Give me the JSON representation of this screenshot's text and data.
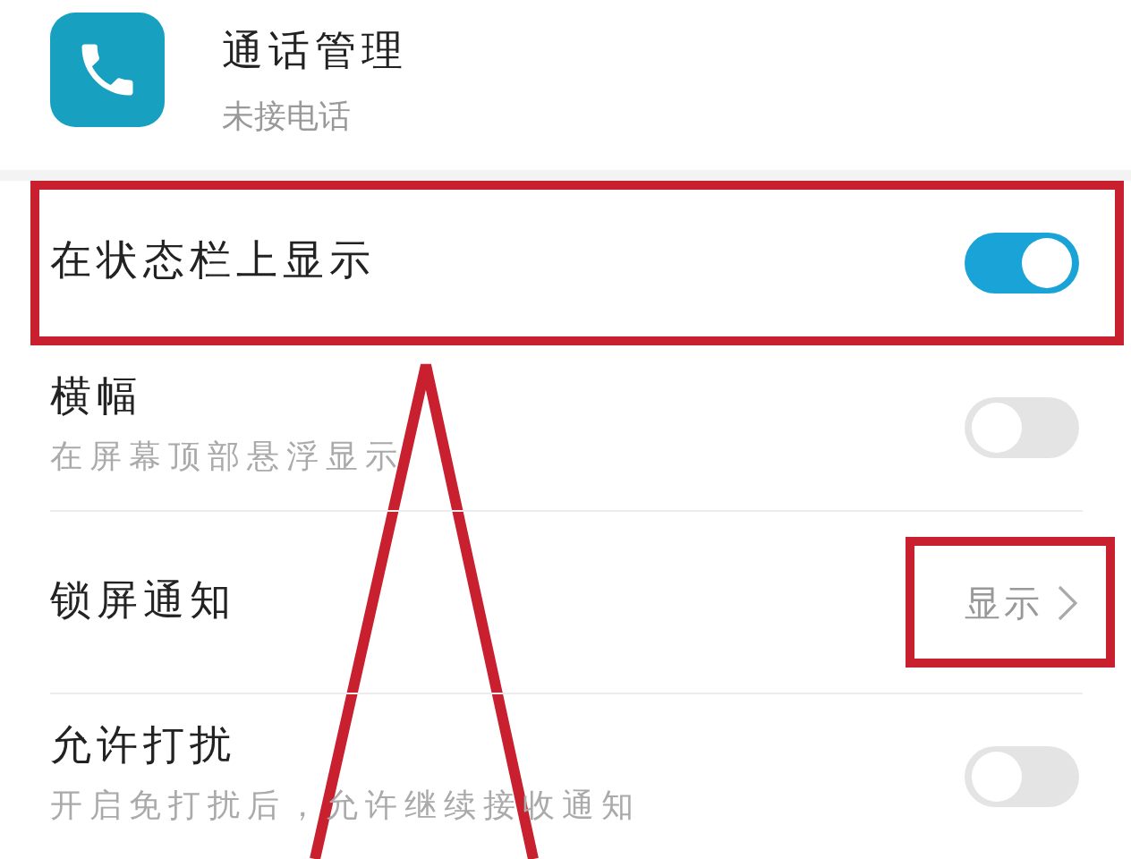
{
  "app": {
    "name": "通话管理",
    "subtitle": "未接电话"
  },
  "settings": [
    {
      "kind": "toggle",
      "label": "在状态栏上显示",
      "on": true,
      "highlighted": true
    },
    {
      "kind": "toggle",
      "label": "横幅",
      "description": "在屏幕顶部悬浮显示",
      "on": false,
      "highlighted": false
    },
    {
      "kind": "link",
      "label": "锁屏通知",
      "value": "显示",
      "highlighted": false,
      "value_highlighted": true
    },
    {
      "kind": "toggle",
      "label": "允许打扰",
      "description": "开启免打扰后，允许继续接收通知",
      "on": false,
      "highlighted": false
    }
  ]
}
